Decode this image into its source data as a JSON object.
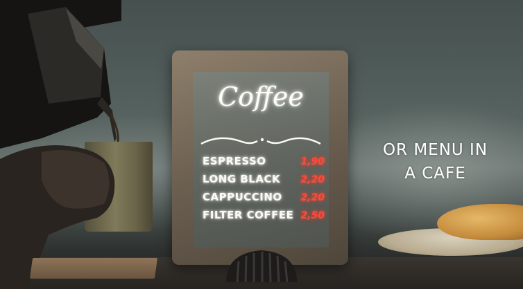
{
  "board": {
    "title": "Coffee",
    "items": [
      {
        "name": "ESPRESSO",
        "price": "1,90"
      },
      {
        "name": "LONG BLACK",
        "price": "2,20"
      },
      {
        "name": "CAPPUCCINO",
        "price": "2,20"
      },
      {
        "name": "FILTER COFFEE",
        "price": "2,50"
      }
    ]
  },
  "caption": {
    "line1": "OR MENU IN",
    "line2": "A CAFE"
  },
  "colors": {
    "chalk_white": "#fbfbf2",
    "price_red": "#ff4a3a"
  }
}
